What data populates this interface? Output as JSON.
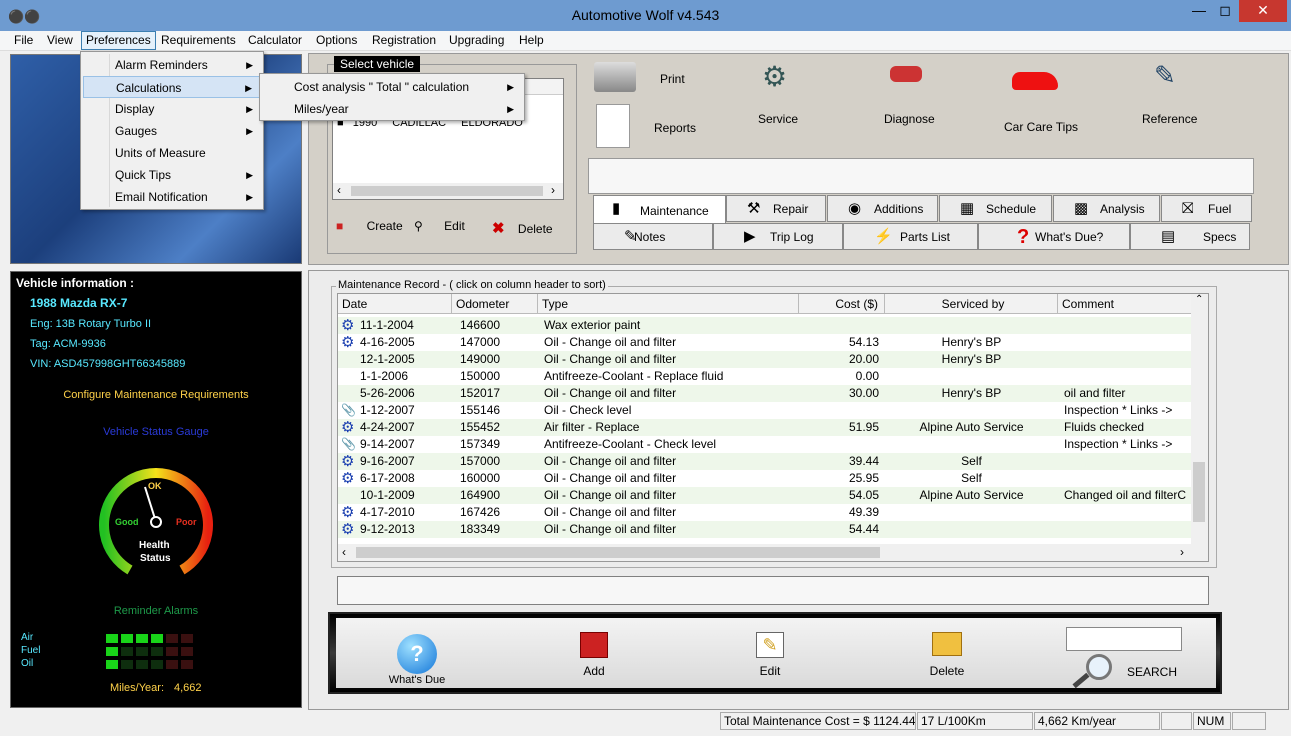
{
  "window": {
    "title": "Automotive Wolf v4.543"
  },
  "menubar": [
    "File",
    "View",
    "Preferences",
    "Requirements",
    "Calculator",
    "Options",
    "Registration",
    "Upgrading",
    "Help"
  ],
  "preferences_menu": [
    {
      "label": "Alarm Reminders",
      "sub": true
    },
    {
      "label": "Calculations",
      "sub": true
    },
    {
      "label": "Display",
      "sub": true
    },
    {
      "label": "Gauges",
      "sub": true
    },
    {
      "label": "Units of Measure",
      "sub": false
    },
    {
      "label": "Quick Tips",
      "sub": true
    },
    {
      "label": "Email Notification",
      "sub": true
    }
  ],
  "calculations_submenu": [
    "Cost analysis \" Total \" calculation",
    "Miles/year"
  ],
  "select_vehicle": {
    "title": "Select vehicle",
    "row": [
      "1990",
      "CADILLAC",
      "ELDORADO"
    ],
    "create": "Create",
    "edit": "Edit",
    "delete": "Delete"
  },
  "toolbar": {
    "print": "Print",
    "reports": "Reports",
    "service": "Service",
    "diagnose": "Diagnose",
    "car_care_tips": "Car Care Tips",
    "reference": "Reference"
  },
  "tabs_row1": [
    "Maintenance",
    "Repair",
    "Additions",
    "Schedule",
    "Analysis",
    "Fuel"
  ],
  "tabs_row2": [
    "Notes",
    "Trip Log",
    "Parts List",
    "What's Due?",
    "Specs"
  ],
  "vehicle": {
    "heading": "Vehicle information :",
    "name": "1988 Mazda RX-7",
    "eng": "Eng:  13B Rotary Turbo II",
    "tag": "Tag:  ACM-9936",
    "vin": "VIN:  ASD457998GHT66345889",
    "configure": "Configure Maintenance Requirements",
    "gauge_title": "Vehicle Status Gauge",
    "gauge_ok": "OK",
    "gauge_good": "Good",
    "gauge_poor": "Poor",
    "gauge_label1": "Health",
    "gauge_label2": "Status",
    "reminder_title": "Reminder Alarms",
    "reminders": [
      {
        "name": "Air",
        "lit": 4
      },
      {
        "name": "Fuel",
        "lit": 1
      },
      {
        "name": "Oil",
        "lit": 1
      }
    ],
    "miles_year_label": "Miles/Year:",
    "miles_year_value": "4,662"
  },
  "maintenance": {
    "caption": "Maintenance Record - ( click on column header to sort)",
    "columns": [
      "Date",
      "Odometer",
      "Type",
      "Cost ($)",
      "Serviced by",
      "Comment"
    ],
    "rows": [
      {
        "icon": "gear",
        "date": "11-1-2004",
        "odo": "146600",
        "type": "Wax exterior paint",
        "cost": "",
        "by": "",
        "comment": ""
      },
      {
        "icon": "gear",
        "date": "4-16-2005",
        "odo": "147000",
        "type": "Oil - Change oil and filter",
        "cost": "54.13",
        "by": "Henry's BP",
        "comment": ""
      },
      {
        "icon": "",
        "date": "12-1-2005",
        "odo": "149000",
        "type": "Oil - Change oil and filter",
        "cost": "20.00",
        "by": "Henry's BP",
        "comment": ""
      },
      {
        "icon": "",
        "date": "1-1-2006",
        "odo": "150000",
        "type": "Antifreeze-Coolant - Replace fluid",
        "cost": "0.00",
        "by": "",
        "comment": ""
      },
      {
        "icon": "",
        "date": "5-26-2006",
        "odo": "152017",
        "type": "Oil - Change oil and filter",
        "cost": "30.00",
        "by": "Henry's BP",
        "comment": "oil and filter"
      },
      {
        "icon": "clip",
        "date": "1-12-2007",
        "odo": "155146",
        "type": "Oil - Check level",
        "cost": "",
        "by": "",
        "comment": "Inspection  * Links ->"
      },
      {
        "icon": "gear",
        "date": "4-24-2007",
        "odo": "155452",
        "type": "Air filter - Replace",
        "cost": "51.95",
        "by": "Alpine Auto Service",
        "comment": "Fluids checked"
      },
      {
        "icon": "clip",
        "date": "9-14-2007",
        "odo": "157349",
        "type": "Antifreeze-Coolant - Check level",
        "cost": "",
        "by": "",
        "comment": "Inspection  * Links ->"
      },
      {
        "icon": "gear",
        "date": "9-16-2007",
        "odo": "157000",
        "type": "Oil - Change oil and filter",
        "cost": "39.44",
        "by": "Self",
        "comment": ""
      },
      {
        "icon": "gear",
        "date": "6-17-2008",
        "odo": "160000",
        "type": "Oil - Change oil and filter",
        "cost": "25.95",
        "by": "Self",
        "comment": ""
      },
      {
        "icon": "",
        "date": "10-1-2009",
        "odo": "164900",
        "type": "Oil - Change oil and filter",
        "cost": "54.05",
        "by": "Alpine Auto Service",
        "comment": "Changed oil and filterC"
      },
      {
        "icon": "gear",
        "date": "4-17-2010",
        "odo": "167426",
        "type": "Oil - Change oil and filter",
        "cost": "49.39",
        "by": "",
        "comment": ""
      },
      {
        "icon": "gear",
        "date": "9-12-2013",
        "odo": "183349",
        "type": "Oil - Change oil and filter",
        "cost": "54.44",
        "by": "",
        "comment": ""
      }
    ]
  },
  "actions": {
    "whats_due": "What's Due",
    "add": "Add",
    "edit": "Edit",
    "delete": "Delete",
    "search_placeholder": "",
    "search": "SEARCH"
  },
  "status": {
    "total": "Total Maintenance Cost = $ 1124.44",
    "economy": "17 L/100Km",
    "rate": "4,662 Km/year",
    "num": "NUM"
  },
  "colors": {
    "titlebar": "#6e9bd0",
    "accent_cyan": "#58e8ff",
    "gauge_yellow": "#ffd24a",
    "row_alt": "#eef7ea"
  }
}
